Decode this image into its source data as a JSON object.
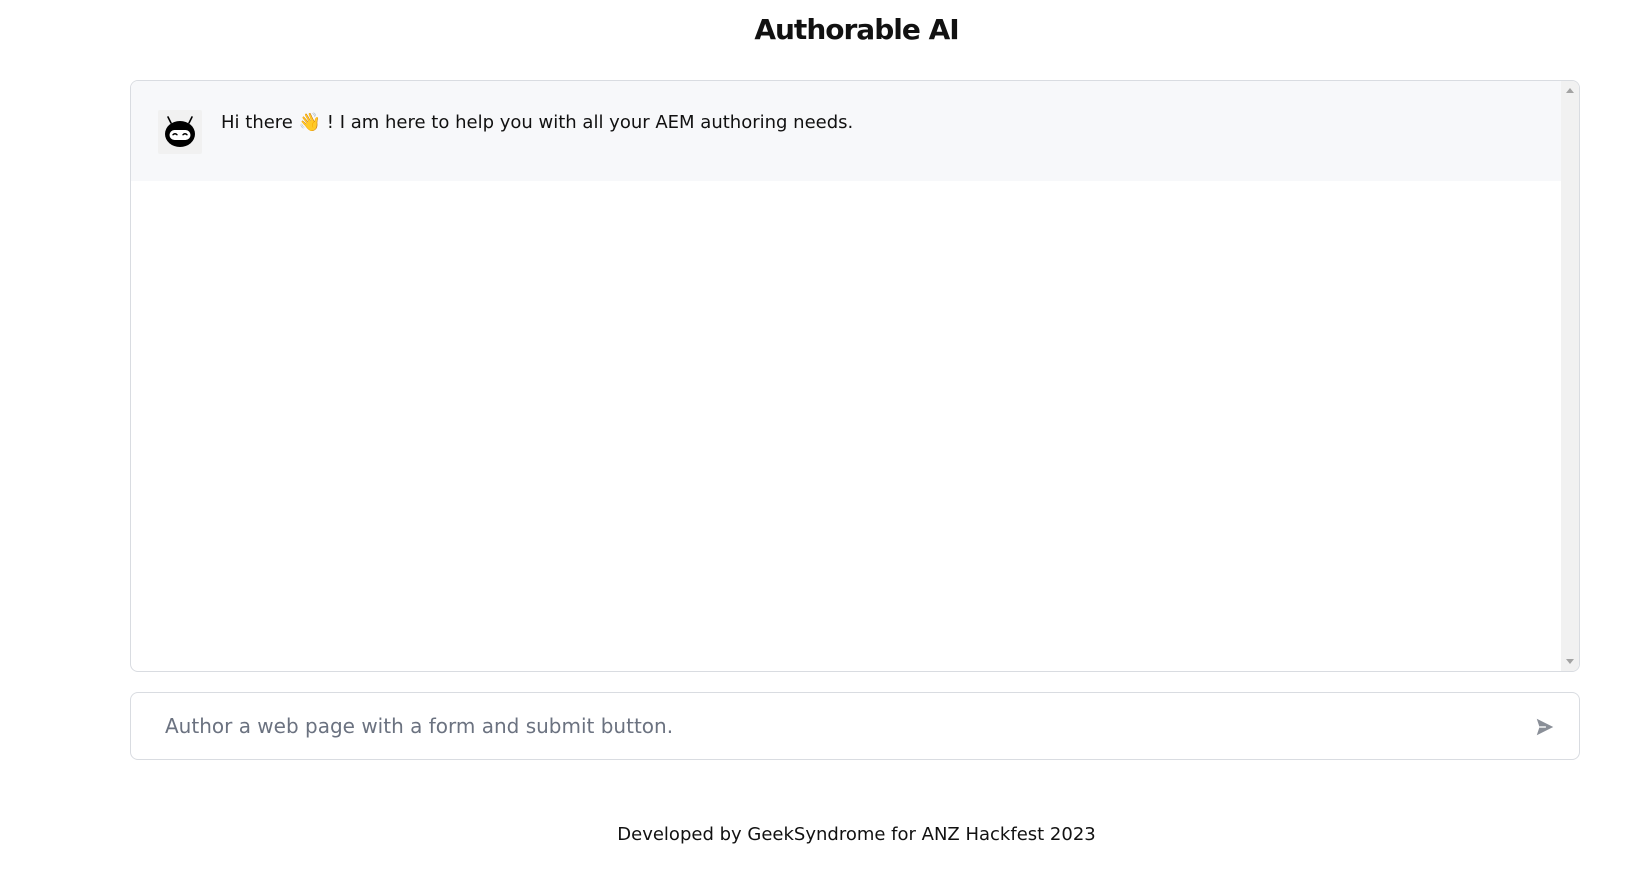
{
  "header": {
    "title": "Authorable AI"
  },
  "chat": {
    "messages": [
      {
        "sender": "bot",
        "avatar_icon": "robot-icon",
        "text_before": "Hi there ",
        "emoji": "👋",
        "text_after": " ! I am here to help you with all your AEM authoring needs."
      }
    ]
  },
  "composer": {
    "placeholder": "Author a web page with a form and submit button.",
    "value": "",
    "send_icon": "send-icon"
  },
  "footer": {
    "text": "Developed by GeekSyndrome for ANZ Hackfest 2023"
  },
  "colors": {
    "message_background": "#f7f8fa",
    "border": "#d9dce1",
    "placeholder": "#6b7280",
    "send_icon": "#8a8f98"
  }
}
